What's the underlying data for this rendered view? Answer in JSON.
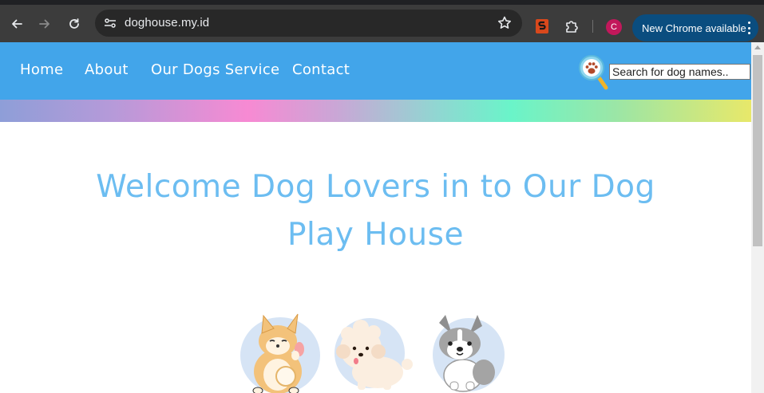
{
  "browser": {
    "url": "doghouse.my.id",
    "profile_initial": "C",
    "update_label": "New Chrome available",
    "accent": "#0a4d7f"
  },
  "site": {
    "nav": [
      "Home",
      "About",
      "Our Dogs Service",
      "Contact"
    ],
    "search_placeholder": "Search for dog names..",
    "nav_color": "#42a5ea",
    "title_color": "#6cbdf1",
    "hero_title_line1": "Welcome Dog Lovers in to Our Dog",
    "hero_title_line2": "Play House"
  },
  "icons": [
    "back-arrow-icon",
    "forward-arrow-icon",
    "reload-icon",
    "site-info-icon",
    "bookmark-star-icon",
    "seo-extension-icon",
    "extensions-puzzle-icon",
    "paw-search-icon"
  ]
}
